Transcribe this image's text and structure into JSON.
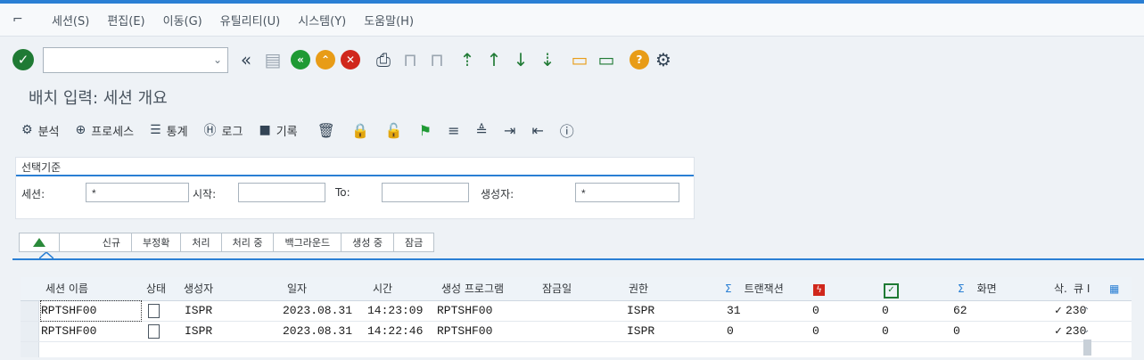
{
  "menubar": {
    "items": [
      "세션(S)",
      "편집(E)",
      "이동(G)",
      "유틸리티(U)",
      "시스템(Y)",
      "도움말(H)"
    ]
  },
  "toolbar": {
    "command_value": "",
    "icons": [
      "check-icon",
      "back-double-icon",
      "save-icon",
      "back-icon",
      "exit-icon",
      "cancel-icon",
      "print-icon",
      "find-icon",
      "find-next-icon",
      "first-page-icon",
      "prev-page-icon",
      "next-page-icon",
      "last-page-icon",
      "new-session-icon",
      "shortcut-icon",
      "help-icon",
      "settings-icon"
    ]
  },
  "page": {
    "title": "배치 입력: 세션 개요"
  },
  "app_toolbar": {
    "analyze": "분석",
    "process": "프로세스",
    "statistics": "통계",
    "log": "로그",
    "record": "기록"
  },
  "selection": {
    "title": "선택기준",
    "session_label": "세션:",
    "session_value": "*",
    "from_label": "시작:",
    "from_value": "",
    "to_label": "To:",
    "to_value": "",
    "creator_label": "생성자:",
    "creator_value": "*"
  },
  "tabs": [
    "신규",
    "부정확",
    "처리",
    "처리 중",
    "백그라운드",
    "생성 중",
    "잠금"
  ],
  "table": {
    "headers": {
      "session_name": "세션 이름",
      "status": "상태",
      "creator": "생성자",
      "date": "일자",
      "time": "시간",
      "program": "생성 프로그램",
      "lock_date": "잠금일",
      "auth": "권한",
      "transactions": "트랜잭션",
      "screens": "화면",
      "del": "삭.",
      "queue": "큐 I"
    },
    "rows": [
      {
        "name": "RPTSHF00",
        "creator": "ISPR",
        "date": "2023.08.31",
        "time": "14:23:09",
        "program": "RPTSHF00",
        "lock": "",
        "auth": "ISPR",
        "transactions": "31",
        "error": "0",
        "done": "0",
        "screens": "62",
        "del": "✓",
        "queue": "230"
      },
      {
        "name": "RPTSHF00",
        "creator": "ISPR",
        "date": "2023.08.31",
        "time": "14:22:46",
        "program": "RPTSHF00",
        "lock": "",
        "auth": "ISPR",
        "transactions": "0",
        "error": "0",
        "done": "0",
        "screens": "0",
        "del": "✓",
        "queue": "230"
      }
    ]
  }
}
